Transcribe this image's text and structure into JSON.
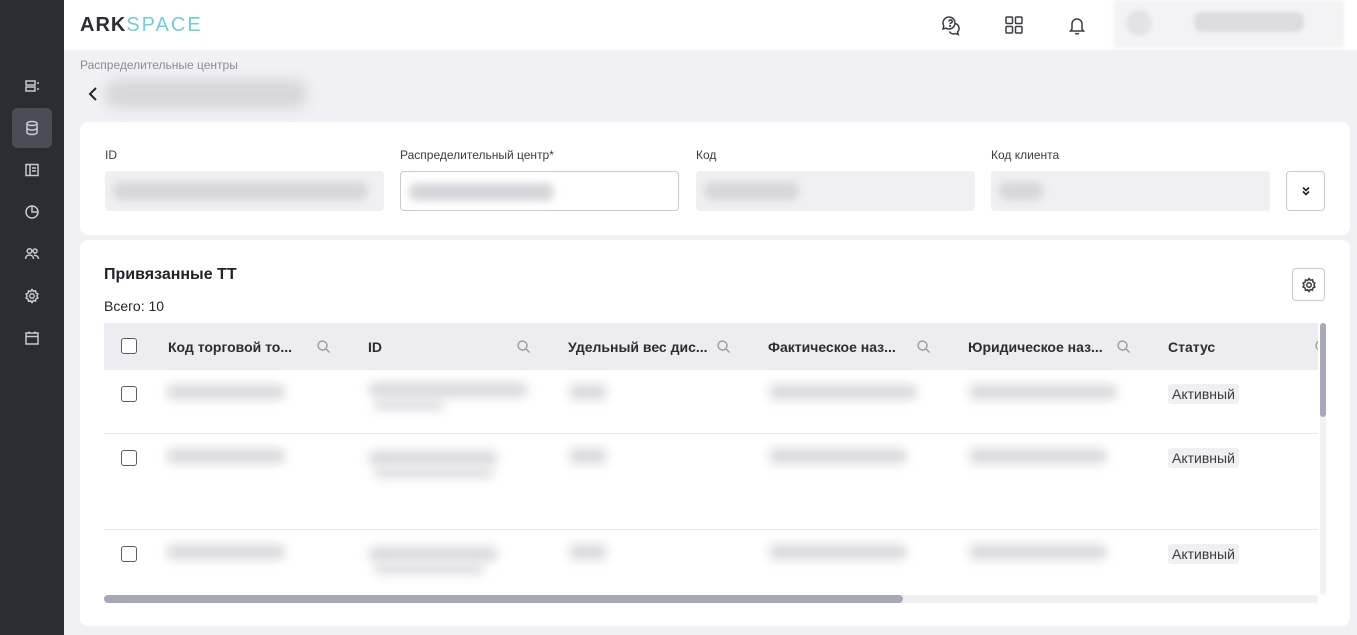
{
  "brand": {
    "part1": "ARK",
    "part2": "SPACE"
  },
  "breadcrumb": "Распределительные центры",
  "form": {
    "fields": [
      {
        "label": "ID"
      },
      {
        "label": "Распределительный центр*"
      },
      {
        "label": "Код"
      },
      {
        "label": "Код клиента"
      }
    ]
  },
  "section": {
    "title": "Привязанные ТТ",
    "total": "Всего: 10"
  },
  "table": {
    "columns": [
      "Код торговой то...",
      "ID",
      "Удельный вес дис...",
      "Фактическое наз...",
      "Юридическое наз...",
      "Статус"
    ],
    "rows": [
      {
        "status": "Активный"
      },
      {
        "status": "Активный"
      },
      {
        "status": "Активный"
      }
    ]
  },
  "icons": {
    "sidebar": [
      "list-icon",
      "database-icon",
      "layout-icon",
      "pie-chart-icon",
      "users-icon",
      "gear-icon",
      "calendar-icon"
    ],
    "topbar": [
      "support-chat-icon",
      "apps-grid-icon",
      "bell-icon"
    ]
  },
  "colors": {
    "sidebar": "#2b2d33",
    "logo_accent": "#6fd0cf",
    "scrollbar": "#a8a9b8"
  }
}
